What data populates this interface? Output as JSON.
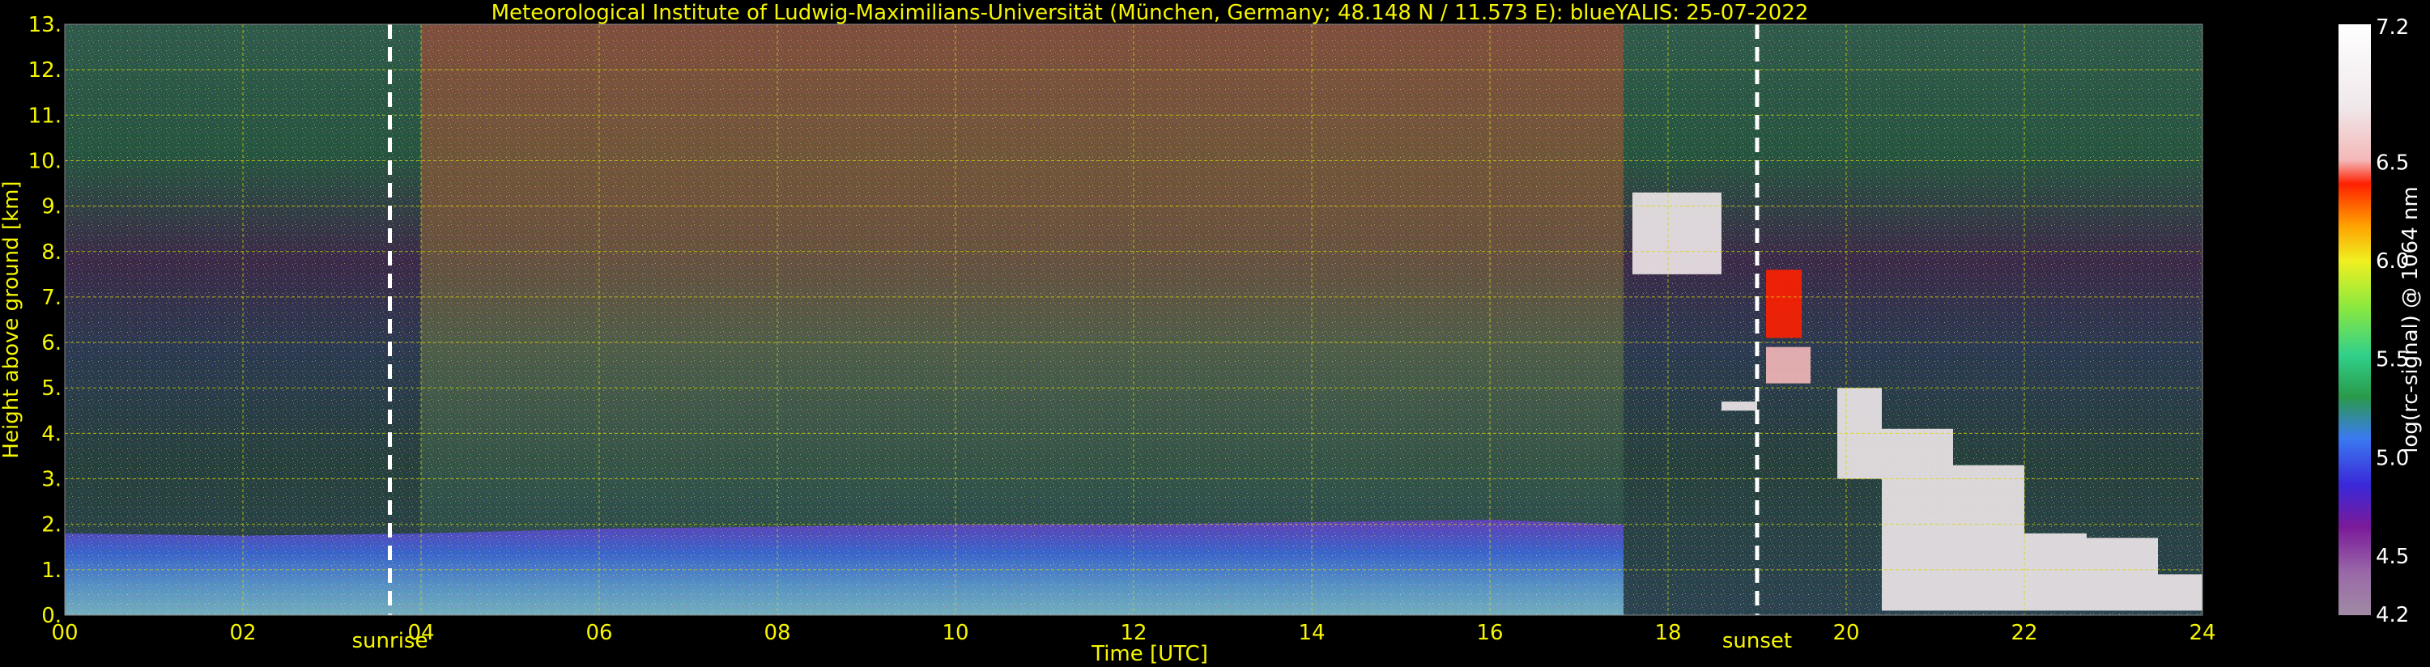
{
  "chart_data": {
    "type": "heatmap",
    "title": "Meteorological Institute of Ludwig-Maximilians-Universität (München, Germany; 48.148 N / 11.573 E):    blueYALIS: 25-07-2022",
    "xlabel": "Time [UTC]",
    "ylabel": "Height above ground [km]",
    "xlim": [
      0,
      24
    ],
    "ylim": [
      0,
      13
    ],
    "x_ticks": [
      "00",
      "02",
      "04",
      "06",
      "08",
      "10",
      "12",
      "14",
      "16",
      "18",
      "20",
      "22",
      "24"
    ],
    "y_ticks": [
      "0.",
      "1.",
      "2.",
      "3.",
      "4.",
      "5.",
      "6.",
      "7.",
      "8.",
      "9.",
      "10.",
      "11.",
      "12.",
      "13."
    ],
    "grid": true,
    "colorbar": {
      "label": "log(rc-signal) @ 1064 nm",
      "range": [
        4.2,
        7.2
      ],
      "ticks": [
        "4.2",
        "4.5",
        "5.0",
        "5.5",
        "6.0",
        "6.5",
        "7.2"
      ],
      "tick_values": [
        4.2,
        4.5,
        5.0,
        5.5,
        6.0,
        6.5,
        7.2
      ]
    },
    "annotations": [
      {
        "label": "sunrise",
        "x": 3.65
      },
      {
        "label": "sunset",
        "x": 19.0
      }
    ],
    "layers": {
      "boundary_layer_top_km": [
        [
          0,
          1.8
        ],
        [
          2,
          1.75
        ],
        [
          4,
          1.8
        ],
        [
          6,
          1.9
        ],
        [
          8,
          1.95
        ],
        [
          10,
          2.0
        ],
        [
          12,
          2.0
        ],
        [
          14,
          2.05
        ],
        [
          16,
          2.1
        ],
        [
          17.5,
          2.0
        ]
      ],
      "cloud_segments": [
        {
          "t0": 17.6,
          "t1": 18.6,
          "h0": 7.5,
          "h1": 9.3,
          "level": 6.8
        },
        {
          "t0": 19.1,
          "t1": 19.5,
          "h0": 6.1,
          "h1": 7.6,
          "level": 6.3
        },
        {
          "t0": 19.1,
          "t1": 19.6,
          "h0": 5.1,
          "h1": 5.9,
          "level": 6.5
        },
        {
          "t0": 18.6,
          "t1": 19.0,
          "h0": 4.5,
          "h1": 4.7,
          "level": 6.8
        },
        {
          "t0": 19.9,
          "t1": 20.4,
          "h0": 3.0,
          "h1": 5.0,
          "level": 6.8
        },
        {
          "t0": 20.4,
          "t1": 21.2,
          "h0": 0.1,
          "h1": 4.1,
          "level": 7.0
        },
        {
          "t0": 21.2,
          "t1": 22.0,
          "h0": 0.1,
          "h1": 3.3,
          "level": 6.9
        },
        {
          "t0": 22.0,
          "t1": 22.7,
          "h0": 0.1,
          "h1": 1.8,
          "level": 6.9
        },
        {
          "t0": 22.7,
          "t1": 23.5,
          "h0": 0.1,
          "h1": 1.7,
          "level": 7.0
        },
        {
          "t0": 23.5,
          "t1": 24.0,
          "h0": 0.1,
          "h1": 0.9,
          "level": 6.9
        }
      ]
    }
  }
}
